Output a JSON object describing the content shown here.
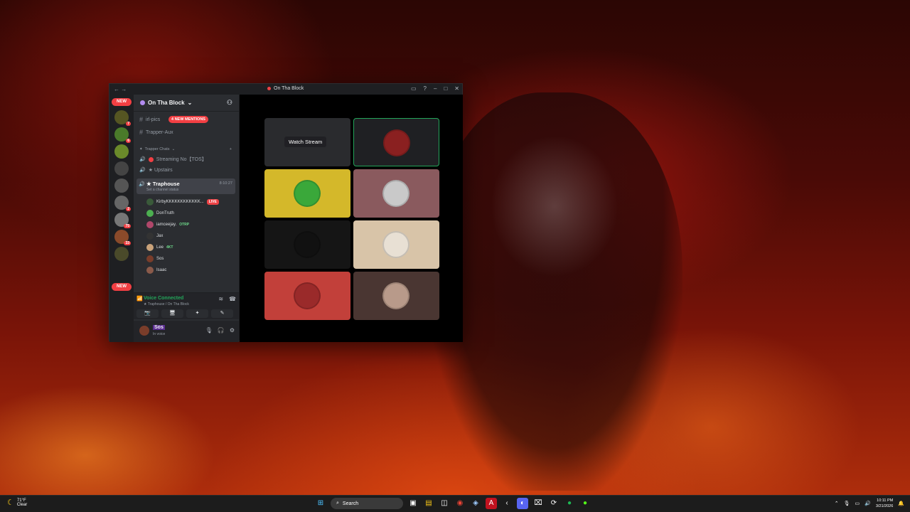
{
  "window": {
    "title": "On Tha Block",
    "nav_back": "←",
    "nav_fwd": "→",
    "buttons": [
      "▭",
      "?",
      "–",
      "□",
      "✕"
    ]
  },
  "guilds": {
    "new_top": "NEW",
    "new_bottom": "NEW",
    "badges": [
      "7",
      "6",
      "2",
      "75",
      "33"
    ]
  },
  "server": {
    "name": "On Tha Block",
    "mentions": "4 NEW MENTIONS",
    "channels": {
      "irl": "irl-pics",
      "trapper_aux": "Trapper-Aux"
    },
    "category": "Trapper Chats",
    "streaming": "Streaming No【TOS】",
    "upstairs": "★ Upstairs",
    "active_channel": {
      "name": "★ Traphouse",
      "status": "Set a channel status",
      "timer": "8:10:27"
    },
    "members": [
      {
        "name": "KirbyKKKKKKKKKKKK...",
        "extra": "LIVE",
        "color": "#3a5a3a"
      },
      {
        "name": "DonTruth",
        "extra": "",
        "color": "#4caf50"
      },
      {
        "name": "iamceejay.",
        "extra": "OTRP",
        "color": "#b0476a"
      },
      {
        "name": "Jax",
        "extra": "",
        "color": "#333"
      },
      {
        "name": "Lee",
        "extra": "4KT",
        "color": "#c9a27a"
      },
      {
        "name": "Sos",
        "extra": "",
        "color": "#7a3d2a"
      },
      {
        "name": "Isaac",
        "extra": "",
        "color": "#8a5a4a"
      }
    ]
  },
  "voice": {
    "status": "Voice Connected",
    "location": "★ Traphouse / On Tha Block",
    "actions": [
      "📷",
      "🖥",
      "✦",
      "✎"
    ]
  },
  "user": {
    "name": "Sos",
    "status": "In voice"
  },
  "stage": {
    "watch_label": "Watch Stream",
    "tiles": [
      {
        "bg": "#2a2b2e",
        "avatar": "",
        "kind": "stream"
      },
      {
        "bg": "#1f2023",
        "avatar": "#8a2020",
        "kind": "speaking"
      },
      {
        "bg": "#d4b82a",
        "avatar": "#3aa83a",
        "kind": "user"
      },
      {
        "bg": "#8a5a5e",
        "avatar": "#c9c9c9",
        "kind": "user"
      },
      {
        "bg": "#151515",
        "avatar": "#111",
        "kind": "user"
      },
      {
        "bg": "#d8c4a8",
        "avatar": "#e8e0d4",
        "kind": "user"
      },
      {
        "bg": "#c2403a",
        "avatar": "#9a2a2a",
        "kind": "user"
      },
      {
        "bg": "#4a3632",
        "avatar": "#b89a8a",
        "kind": "user"
      }
    ]
  },
  "taskbar": {
    "temp": "71°F",
    "weather": "Clear",
    "search": "Search",
    "time": "10:11 PM",
    "date": "3/21/2026"
  }
}
